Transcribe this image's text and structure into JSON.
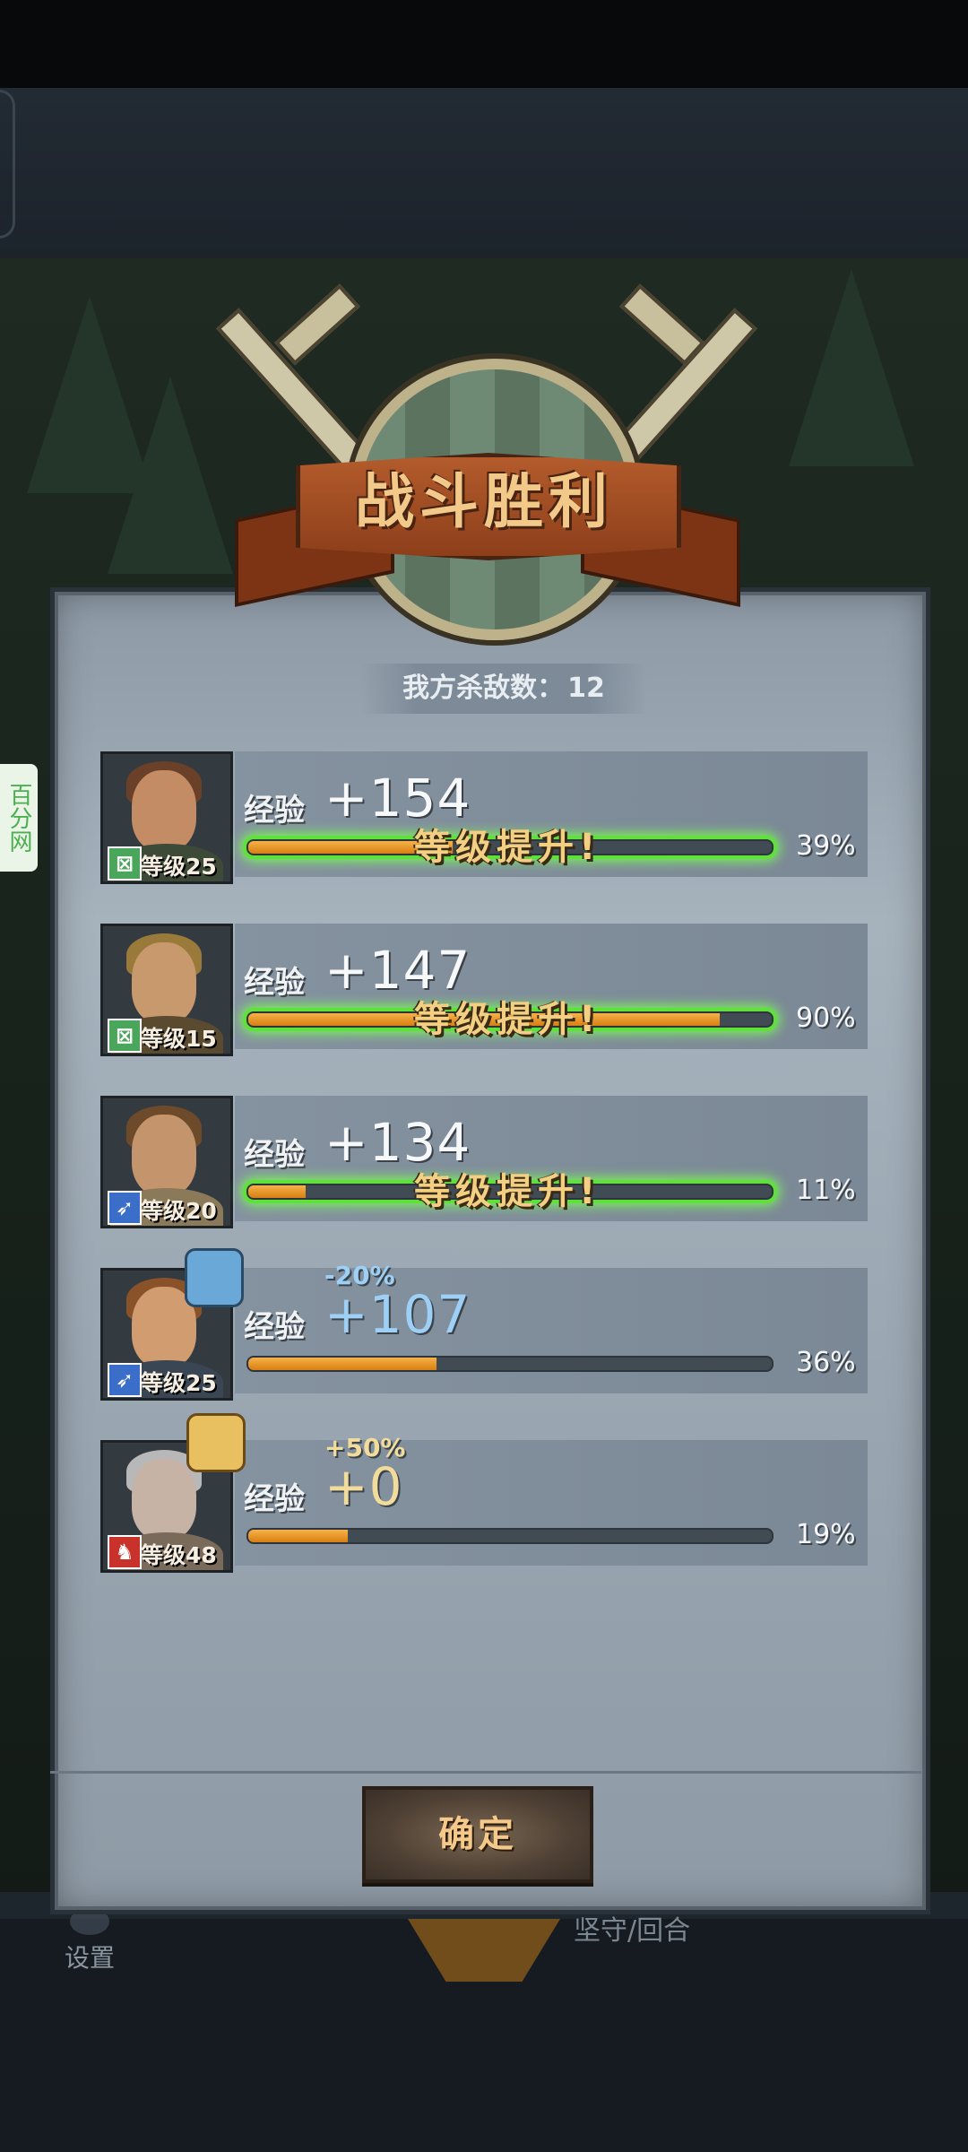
{
  "title": "战斗胜利",
  "kills": {
    "label": "我方杀敌数：",
    "value": "12"
  },
  "side_badge": "百分网",
  "units": [
    {
      "level_text": "等级25",
      "exp_label": "经验",
      "exp_gain": "+154",
      "level_up": "等级提升!",
      "progress_text": "39%",
      "progress": 0.39,
      "modifier": "",
      "class_color": "#4aa65a",
      "class_symbol": "⊠"
    },
    {
      "level_text": "等级15",
      "exp_label": "经验",
      "exp_gain": "+147",
      "level_up": "等级提升!",
      "progress_text": "90%",
      "progress": 0.9,
      "modifier": "",
      "class_color": "#4aa65a",
      "class_symbol": "⊠"
    },
    {
      "level_text": "等级20",
      "exp_label": "经验",
      "exp_gain": "+134",
      "level_up": "等级提升!",
      "progress_text": "11%",
      "progress": 0.11,
      "modifier": "",
      "class_color": "#3a6ec8",
      "class_symbol": "➶"
    },
    {
      "level_text": "等级25",
      "exp_label": "经验",
      "exp_gain": "+107",
      "level_up": "",
      "progress_text": "36%",
      "progress": 0.36,
      "modifier": "-20%",
      "class_color": "#3a6ec8",
      "class_symbol": "➶"
    },
    {
      "level_text": "等级48",
      "exp_label": "经验",
      "exp_gain": "+0",
      "level_up": "",
      "progress_text": "19%",
      "progress": 0.19,
      "modifier": "+50%",
      "class_color": "#c8322a",
      "class_symbol": "♞"
    }
  ],
  "confirm_label": "确定",
  "bottom": {
    "settings_label": "设置",
    "defend_label": "坚守/回合"
  }
}
